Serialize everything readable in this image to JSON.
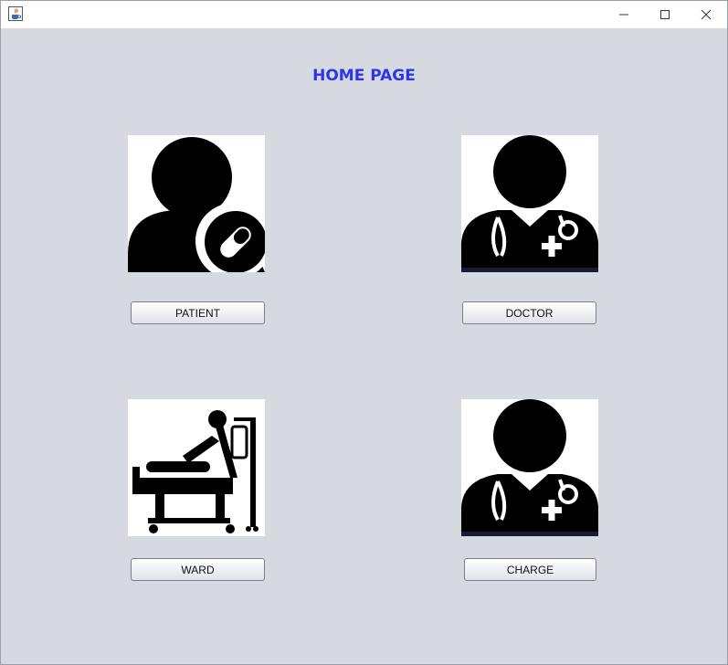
{
  "window": {
    "app_icon": "java-cup-icon",
    "controls": [
      "minimize-icon",
      "maximize-icon",
      "close-icon"
    ]
  },
  "page": {
    "title": "HOME PAGE",
    "title_color": "#2d36e6",
    "background_color": "#d6d9e0"
  },
  "tiles": [
    {
      "icon": "patient-icon",
      "button_label": "PATIENT"
    },
    {
      "icon": "doctor-icon",
      "button_label": "DOCTOR"
    },
    {
      "icon": "hospital-bed-icon",
      "button_label": "WARD"
    },
    {
      "icon": "doctor-icon",
      "button_label": "CHARGE"
    }
  ]
}
